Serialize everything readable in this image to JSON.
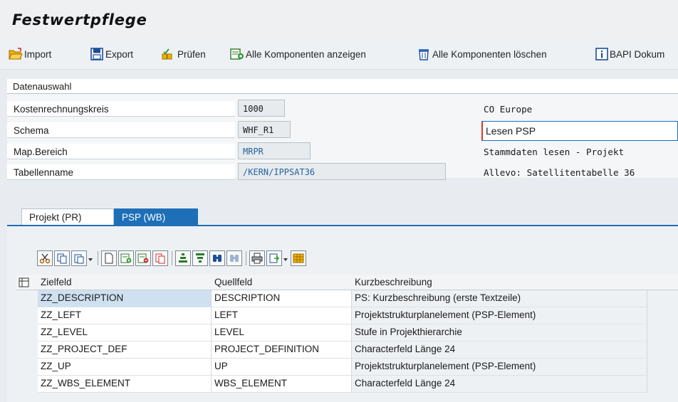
{
  "window": {
    "title": "Festwertpflege"
  },
  "toolbar": {
    "import_label": "Import",
    "export_label": "Export",
    "check_label": "Prüfen",
    "show_all_label": "Alle Komponenten anzeigen",
    "delete_all_label": "Alle Komponenten löschen",
    "bapi_label": "BAPI Dokum"
  },
  "selection": {
    "header": "Datenauswahl",
    "kokrs_label": "Kostenrechnungskreis",
    "kokrs_value": "1000",
    "kokrs_desc": "CO Europe",
    "schema_label": "Schema",
    "schema_value": "WHF_R1",
    "schema_desc": "Lesen PSP",
    "mapbereich_label": "Map.Bereich",
    "mapbereich_value": "MRPR",
    "mapbereich_desc": "Stammdaten lesen - Projekt",
    "table_label": "Tabellenname",
    "table_value": "/KERN/IPPSAT36",
    "table_desc": "Allevo: Satellitentabelle 36"
  },
  "tabs": [
    {
      "label": "Projekt (PR)",
      "active": false
    },
    {
      "label": "PSP (WB)",
      "active": true
    }
  ],
  "grid": {
    "columns": [
      "Zielfeld",
      "Quellfeld",
      "Kurzbeschreibung"
    ],
    "rows": [
      [
        "ZZ_DESCRIPTION",
        "DESCRIPTION",
        "PS: Kurzbeschreibung (erste Textzeile)"
      ],
      [
        "ZZ_LEFT",
        "LEFT",
        "Projektstrukturplanelement (PSP-Element)"
      ],
      [
        "ZZ_LEVEL",
        "LEVEL",
        "Stufe in Projekthierarchie"
      ],
      [
        "ZZ_PROJECT_DEF",
        "PROJECT_DEFINITION",
        "Characterfeld Länge 24"
      ],
      [
        "ZZ_UP",
        "UP",
        "Projektstrukturplanelement (PSP-Element)"
      ],
      [
        "ZZ_WBS_ELEMENT",
        "WBS_ELEMENT",
        "Characterfeld Länge 24"
      ]
    ]
  },
  "colors": {
    "accent": "#1e6fb8",
    "selected_row": "#cfe1f0",
    "field_link": "#27649d"
  }
}
